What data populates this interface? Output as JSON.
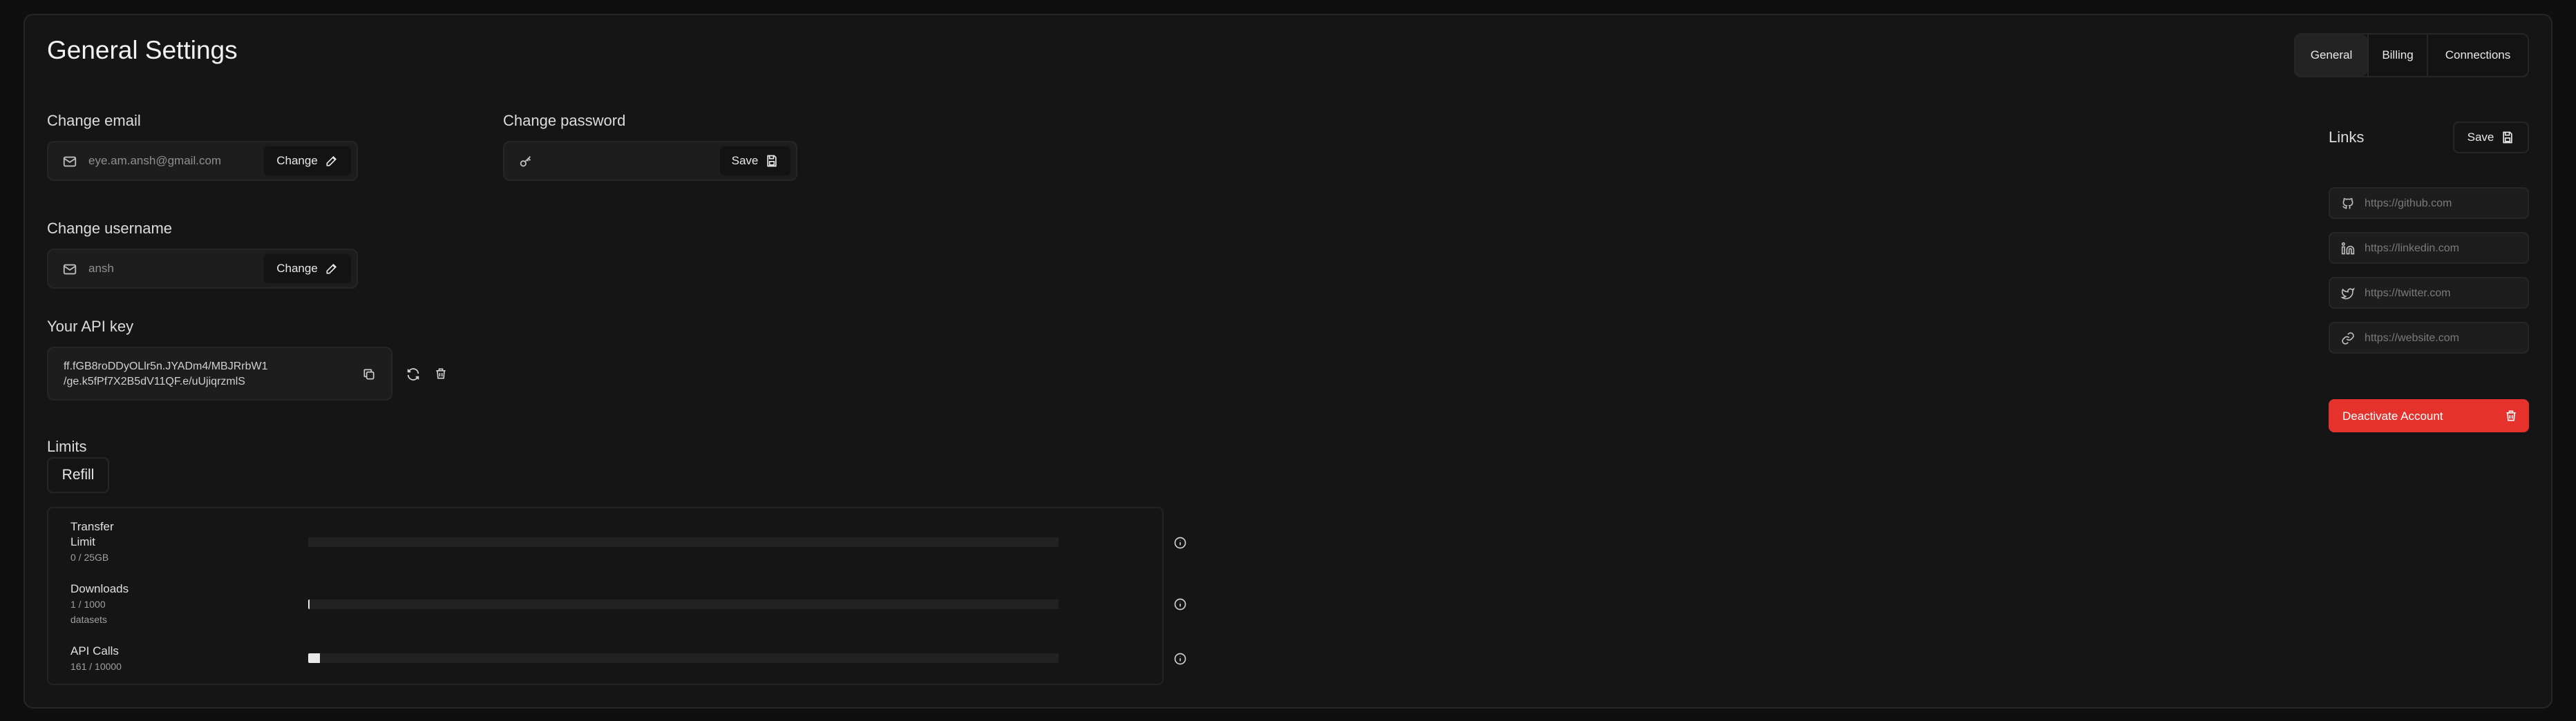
{
  "header": {
    "title": "General Settings"
  },
  "tabs": [
    {
      "label": "General",
      "active": true
    },
    {
      "label": "Billing",
      "active": false
    },
    {
      "label": "Connections",
      "active": false
    }
  ],
  "email": {
    "label": "Change email",
    "value": "eye.am.ansh@gmail.com",
    "button": "Change",
    "icon": "mail-icon"
  },
  "password": {
    "label": "Change password",
    "value": "",
    "button": "Save",
    "icon": "key-icon"
  },
  "username": {
    "label": "Change username",
    "value": "ansh",
    "button": "Change",
    "icon": "mail-icon"
  },
  "api_key": {
    "label": "Your API key",
    "line1": "ff.fGB8roDDyOLlr5n.JYADm4/MBJRrbW1",
    "line2": "/ge.k5fPf7X2B5dV11QF.e/uUjiqrzmlS"
  },
  "limits": {
    "label": "Limits",
    "refill_button": "Refill",
    "rows": [
      {
        "name": "Transfer Limit",
        "name_line1": "Transfer",
        "name_line2": "Limit",
        "usage": "0 / 25GB",
        "progress": 0.0
      },
      {
        "name": "Downloads",
        "usage": "1 / 1000",
        "usage2": "datasets",
        "progress": 0.001
      },
      {
        "name": "API Calls",
        "usage": "161 / 10000",
        "progress": 0.0161
      }
    ]
  },
  "links": {
    "label": "Links",
    "save_button": "Save",
    "items": [
      {
        "icon": "github-icon",
        "placeholder": "https://github.com"
      },
      {
        "icon": "linkedin-icon",
        "placeholder": "https://linkedin.com"
      },
      {
        "icon": "twitter-icon",
        "placeholder": "https://twitter.com"
      },
      {
        "icon": "link-icon",
        "placeholder": "https://website.com"
      }
    ]
  },
  "deactivate": {
    "label": "Deactivate Account",
    "color": "#e5322d"
  },
  "colors": {
    "background": "#0f0f0f",
    "panel": "#151515",
    "danger": "#e5322d"
  }
}
